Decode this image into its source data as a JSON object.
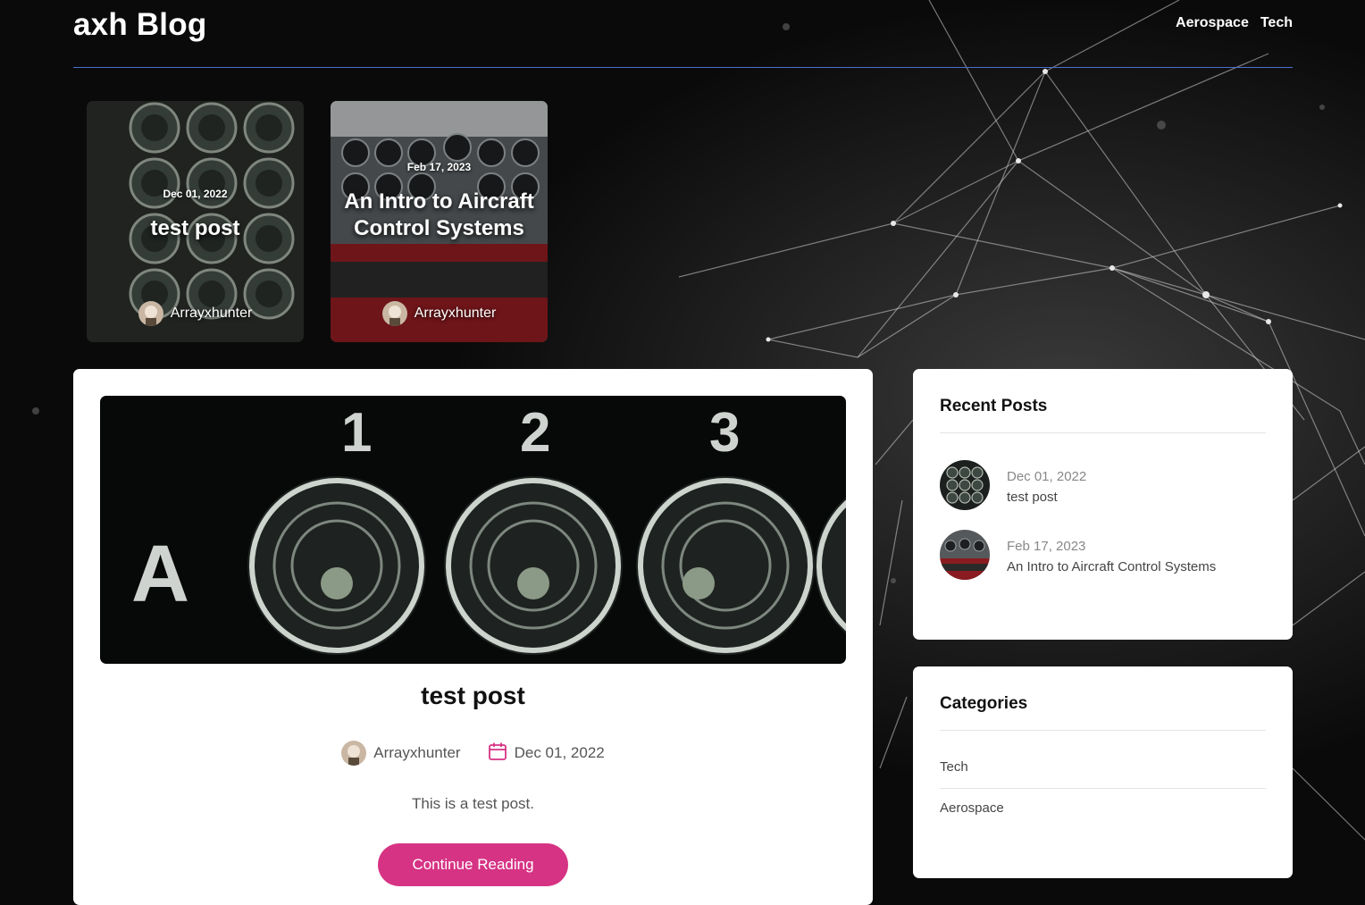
{
  "header": {
    "brand": "axh Blog",
    "nav": [
      {
        "label": "Aerospace"
      },
      {
        "label": "Tech"
      }
    ]
  },
  "featured": [
    {
      "date": "Dec 01, 2022",
      "title": "test post",
      "author": "Arrayxhunter"
    },
    {
      "date": "Feb 17, 2023",
      "title": "An Intro to Aircraft Control Systems",
      "author": "Arrayxhunter"
    }
  ],
  "post": {
    "title": "test post",
    "author": "Arrayxhunter",
    "date": "Dec 01, 2022",
    "excerpt": "This is a test post.",
    "button_label": "Continue Reading",
    "image_labels": {
      "row": "A",
      "col1": "1",
      "col2": "2",
      "col3": "3"
    }
  },
  "sidebar": {
    "recent": {
      "title": "Recent Posts",
      "items": [
        {
          "date": "Dec 01, 2022",
          "title": "test post"
        },
        {
          "date": "Feb 17, 2023",
          "title": "An Intro to Aircraft Control Systems"
        }
      ]
    },
    "categories": {
      "title": "Categories",
      "items": [
        {
          "label": "Tech"
        },
        {
          "label": "Aerospace"
        }
      ]
    }
  },
  "colors": {
    "accent": "#d63384",
    "rule": "#4a6fd0",
    "background": "#0a0a0a"
  }
}
